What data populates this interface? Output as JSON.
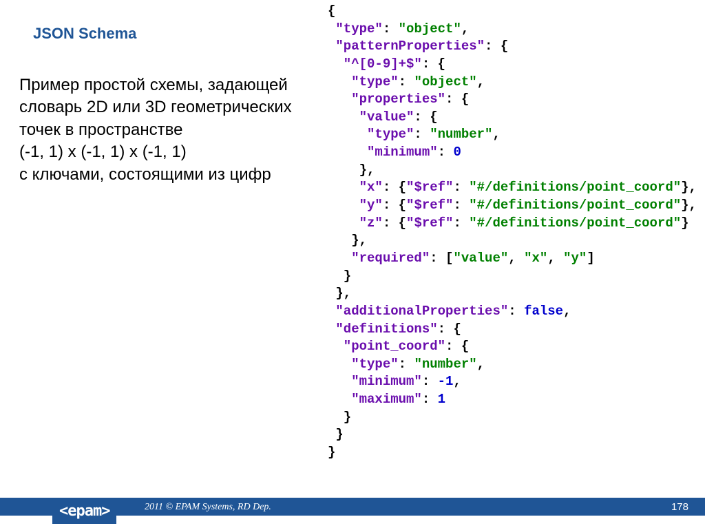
{
  "title": "JSON Schema",
  "description": "Пример простой схемы, задающей словарь 2D или 3D геометрических точек в пространстве\n(-1, 1) x (-1, 1) x (-1, 1)\nс ключами, состоящими из цифр",
  "code": {
    "l01": "{",
    "l02a": " \"type\"",
    "l02b": ": ",
    "l02c": "\"object\"",
    "l02d": ",",
    "l03a": " \"patternProperties\"",
    "l03b": ": {",
    "l04a": "  \"^[0-9]+$\"",
    "l04b": ": {",
    "l05a": "   \"type\"",
    "l05b": ": ",
    "l05c": "\"object\"",
    "l05d": ",",
    "l06a": "   \"properties\"",
    "l06b": ": {",
    "l07a": "    \"value\"",
    "l07b": ": {",
    "l08a": "     \"type\"",
    "l08b": ": ",
    "l08c": "\"number\"",
    "l08d": ",",
    "l09a": "     \"minimum\"",
    "l09b": ": ",
    "l09c": "0",
    "l10": "    },",
    "l11a": "    \"x\"",
    "l11b": ": {",
    "l11c": "\"$ref\"",
    "l11d": ": ",
    "l11e": "\"#/definitions/point_coord\"",
    "l11f": "},",
    "l12a": "    \"y\"",
    "l12b": ": {",
    "l12c": "\"$ref\"",
    "l12d": ": ",
    "l12e": "\"#/definitions/point_coord\"",
    "l12f": "},",
    "l13a": "    \"z\"",
    "l13b": ": {",
    "l13c": "\"$ref\"",
    "l13d": ": ",
    "l13e": "\"#/definitions/point_coord\"",
    "l13f": "}",
    "l14": "   },",
    "l15a": "   \"required\"",
    "l15b": ": [",
    "l15c": "\"value\"",
    "l15d": ", ",
    "l15e": "\"x\"",
    "l15f": ", ",
    "l15g": "\"y\"",
    "l15h": "]",
    "l16": "  }",
    "l17": " },",
    "l18a": " \"additionalProperties\"",
    "l18b": ": ",
    "l18c": "false",
    "l18d": ",",
    "l19a": " \"definitions\"",
    "l19b": ": {",
    "l20a": "  \"point_coord\"",
    "l20b": ": {",
    "l21a": "   \"type\"",
    "l21b": ": ",
    "l21c": "\"number\"",
    "l21d": ",",
    "l22a": "   \"minimum\"",
    "l22b": ": ",
    "l22c": "-1",
    "l22d": ",",
    "l23a": "   \"maximum\"",
    "l23b": ": ",
    "l23c": "1",
    "l24": "  }",
    "l25": " }",
    "l26": "}"
  },
  "footer": {
    "logo": "<epam>",
    "copyright": "2011 © EPAM Systems, RD Dep.",
    "page": "178"
  }
}
